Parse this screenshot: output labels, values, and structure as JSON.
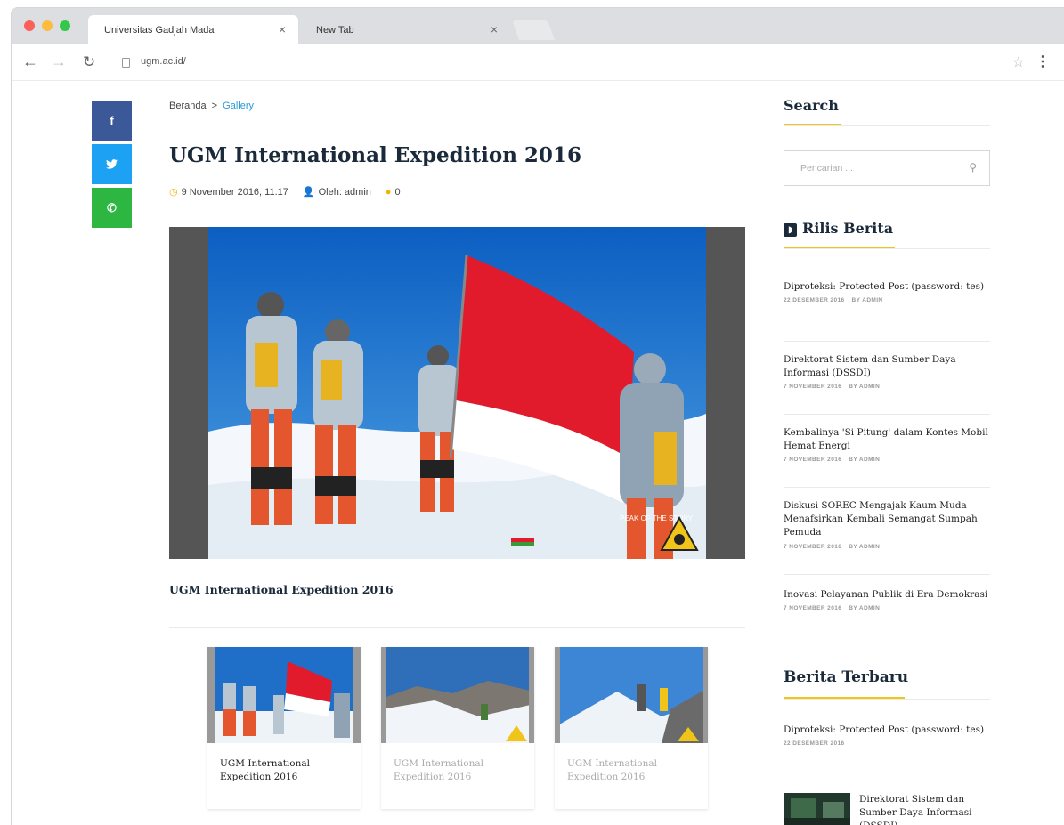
{
  "browser": {
    "tabs": [
      {
        "title": "Universitas Gadjah Mada"
      },
      {
        "title": "New Tab"
      }
    ],
    "url": "ugm.ac.id/",
    "tab_close_glyph": "×"
  },
  "share": {
    "facebook_glyph": "f",
    "twitter_glyph": "t",
    "whatsapp_glyph": "✆"
  },
  "breadcrumb": {
    "home": "Beranda",
    "separator": ">",
    "current": "Gallery"
  },
  "article": {
    "title": "UGM International Expedition 2016",
    "date": "9 November 2016, 11.17",
    "author": "Oleh: admin",
    "comments": "0",
    "caption": "UGM International Expedition 2016",
    "photo_overlay_text": "PEAK OF THE STORY"
  },
  "gallery": {
    "thumbnails": [
      {
        "caption": "UGM International Expedition 2016"
      },
      {
        "caption": "UGM International Expedition 2016"
      },
      {
        "caption": "UGM International Expedition 2016"
      }
    ]
  },
  "sidebar": {
    "search": {
      "title": "Search",
      "placeholder": "Pencarian ..."
    },
    "releases": {
      "title": "Rilis Berita",
      "items": [
        {
          "title": "Diproteksi: Protected Post (password: tes)",
          "date": "22 DESEMBER 2016",
          "author": "BY ADMIN"
        },
        {
          "title": "Direktorat Sistem dan Sumber Daya Informasi (DSSDI)",
          "date": "7 NOVEMBER 2016",
          "author": "BY ADMIN"
        },
        {
          "title": "Kembalinya 'Si Pitung' dalam Kontes Mobil Hemat Energi",
          "date": "7 NOVEMBER 2016",
          "author": "BY ADMIN"
        },
        {
          "title": "Diskusi SOREC Mengajak Kaum Muda Menafsirkan Kembali Semangat Sumpah Pemuda",
          "date": "7 NOVEMBER 2016",
          "author": "BY ADMIN"
        },
        {
          "title": "Inovasi Pelayanan Publik di Era Demokrasi",
          "date": "7 NOVEMBER 2016",
          "author": "BY ADMIN"
        }
      ]
    },
    "latest": {
      "title": "Berita Terbaru",
      "items": [
        {
          "title": "Diproteksi: Protected Post (password: tes)",
          "date": "22 DESEMBER 2016"
        },
        {
          "title": "Direktorat Sistem dan Sumber Daya Informasi (DSSDI)"
        }
      ]
    }
  },
  "colors": {
    "facebook": "#3b5998",
    "twitter": "#1da1f2",
    "whatsapp": "#2db742",
    "accent": "#f0c419",
    "link": "#2a9bd8",
    "heading": "#1a2a3a"
  }
}
